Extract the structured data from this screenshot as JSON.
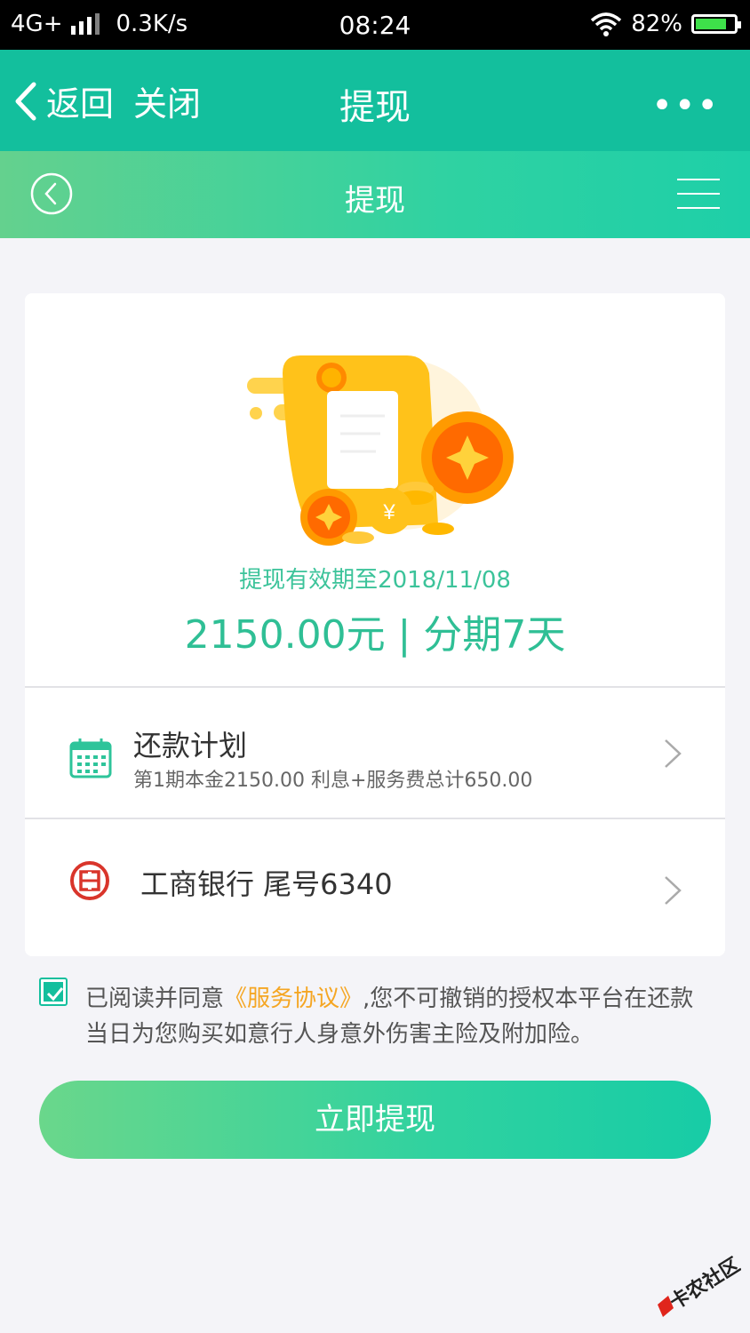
{
  "status_bar": {
    "network": "4G+",
    "speed": "0.3K/s",
    "time": "08:24",
    "battery": "82%",
    "battery_level": 0.82
  },
  "nav": {
    "back_label": "返回",
    "close_label": "关闭",
    "title": "提现",
    "more_label": "•••"
  },
  "sub_header": {
    "title": "提现"
  },
  "card": {
    "valid_text": "提现有效期至2018/11/08",
    "amount_text": "2150.00元 | 分期7天",
    "repayment": {
      "title": "还款计划",
      "subtitle": "第1期本金2150.00 利息+服务费总计650.00"
    },
    "bank": {
      "label": "工商银行 尾号6340"
    }
  },
  "agreement": {
    "checked": true,
    "prefix": "已阅读并同意",
    "link": "《服务协议》",
    "suffix": ",您不可撤销的授权本平台在还款当日为您购买如意行人身意外伤害主险及附加险。"
  },
  "submit_label": "立即提现",
  "watermark": "卡农社区",
  "colors": {
    "primary": "#13bf9d",
    "amount": "#2fbf95",
    "link": "#f5a623"
  },
  "icons": [
    "back-chevron-icon",
    "more-icon",
    "circle-back-icon",
    "menu-icon",
    "coins-illustration",
    "calendar-icon",
    "icbc-bank-icon",
    "chevron-right-icon",
    "checkbox-icon"
  ]
}
